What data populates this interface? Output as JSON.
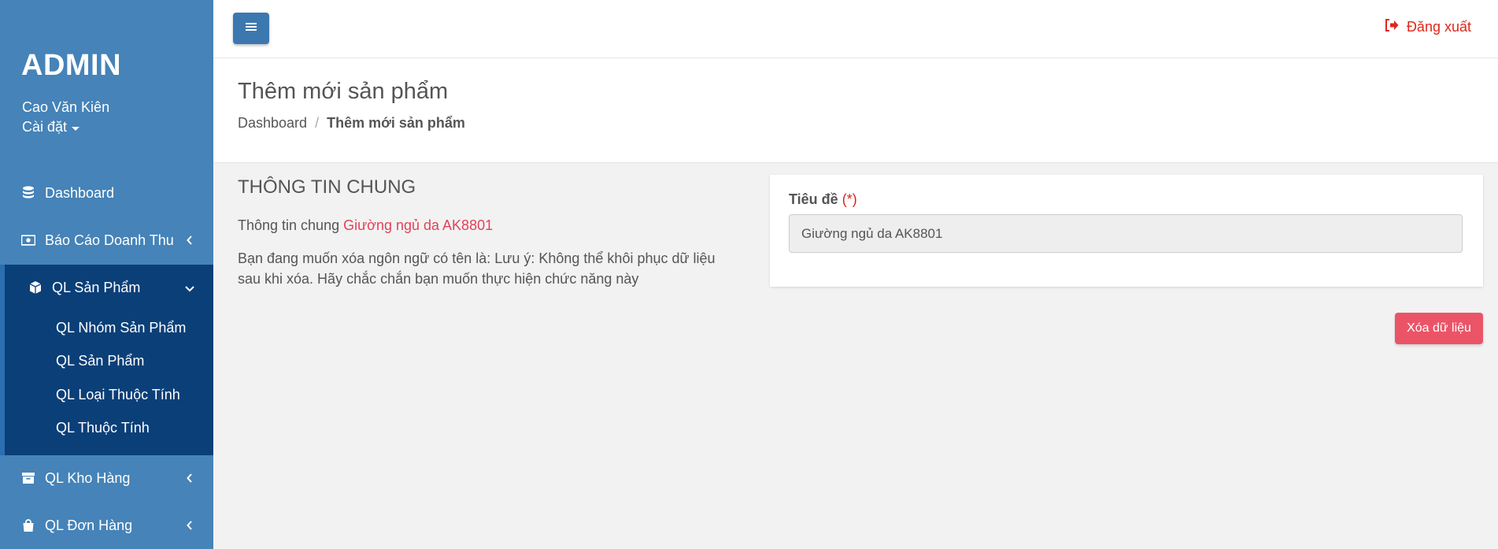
{
  "sidebar": {
    "brand": "ADMIN",
    "user_name": "Cao Văn Kiên",
    "settings_label": "Cài đặt",
    "items": [
      {
        "label": "Dashboard",
        "icon": "database-icon"
      },
      {
        "label": "Báo Cáo Doanh Thu",
        "icon": "money-icon"
      },
      {
        "label": "QL Sản Phẩm",
        "icon": "cube-icon"
      },
      {
        "label": "QL Kho Hàng",
        "icon": "archive-icon"
      },
      {
        "label": "QL Đơn Hàng",
        "icon": "shopping-bag-icon"
      }
    ],
    "submenu": [
      {
        "label": "QL Nhóm Sản Phẩm"
      },
      {
        "label": "QL Sản Phẩm"
      },
      {
        "label": "QL Loại Thuộc Tính"
      },
      {
        "label": "QL Thuộc Tính"
      }
    ]
  },
  "topbar": {
    "menu_toggle_icon": "bars-icon",
    "logout_label": "Đăng xuất",
    "logout_icon": "sign-out-icon"
  },
  "header": {
    "title": "Thêm mới sản phẩm",
    "breadcrumb": [
      {
        "label": "Dashboard"
      },
      {
        "label": "Thêm mới sản phẩm"
      }
    ],
    "breadcrumb_separator": "/"
  },
  "main": {
    "section_title": "THÔNG TIN CHUNG",
    "info_prefix": "Thông tin chung",
    "info_highlight": "Giường ngủ da AK8801",
    "warning": "Bạn đang muốn xóa ngôn ngữ có tên là: Lưu ý: Không thể khôi phục dữ liệu sau khi xóa. Hãy chắc chắn bạn muốn thực hiện chức năng này",
    "form": {
      "title_label": "Tiêu đề",
      "required_mark": "(*)",
      "title_value": "Giường ngủ da AK8801"
    },
    "delete_button": "Xóa dữ liệu"
  },
  "colors": {
    "sidebar_bg": "#4583b8",
    "submenu_bg": "#0b3f78",
    "accent_red": "#e0435a",
    "delete_btn": "#eb5467",
    "logout": "#e0261b"
  }
}
